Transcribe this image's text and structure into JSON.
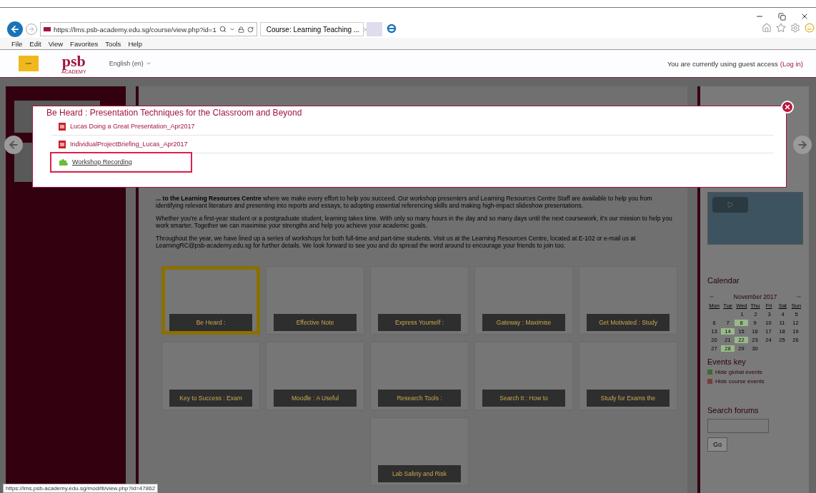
{
  "browser": {
    "address": "https://lms.psb-academy.edu.sg/course/view.php?id=1",
    "tab_title": "Course: Learning Teaching ...",
    "menu": [
      "File",
      "Edit",
      "View",
      "Favorites",
      "Tools",
      "Help"
    ]
  },
  "header": {
    "logo": "psb",
    "logo_sub": "ACADEMY",
    "language": "English (en)",
    "guest_text": "You are currently using guest access",
    "login_link": "(Log in)"
  },
  "modal": {
    "title": "Be Heard : Presentation Techniques for the Classroom and Beyond",
    "items": [
      {
        "kind": "pdf",
        "label": "Lucas Doing a Great Presentation_Apr2017",
        "selected": false
      },
      {
        "kind": "pdf",
        "label": "IndividualProjectBriefing_Lucas_Apr2017",
        "selected": false
      },
      {
        "kind": "tool",
        "label": "Workshop Recording",
        "selected": true
      }
    ]
  },
  "intro": [
    "**... to the Learning Resources Centre** where we make every effort to help you succeed. Our workshop presenters and Learning Resources Centre Staff are available to help you from identifying relevant literature and presenting into reports and essays, to adopting essential referencing skills and making high-impact slideshow presentations.",
    "Whether you're a first-year student or a postgraduate student, learning takes time. With only so many hours in the day and so many days until the next coursework, it's our mission to help you work smarter. Together we can maximise your strengths and help you achieve your academic goals.",
    "Throughout the year, we have lined up a series of workshops for both full-time and part-time students. Visit us at the Learning Resources Centre, located at E-102 or e-mail us at LearningRC@psb-academy.edu.sg for further details. We look forward to see you and do spread the word around to encourage your friends to join too."
  ],
  "tiles": [
    {
      "label": "Be Heard :",
      "selected": true
    },
    {
      "label": "Effective Note",
      "selected": false
    },
    {
      "label": "Express Yourself :",
      "selected": false
    },
    {
      "label": "Gateway : Maximise",
      "selected": false
    },
    {
      "label": "Get Motivated : Study",
      "selected": false
    },
    {
      "label": "Key to Success : Exam",
      "selected": false
    },
    {
      "label": "Moodle : A Useful",
      "selected": false
    },
    {
      "label": "Research Tools :",
      "selected": false
    },
    {
      "label": "Search It : How to",
      "selected": false
    },
    {
      "label": "Study for Exams the",
      "selected": false
    },
    {
      "label": "Lab Safety and Risk",
      "selected": false
    }
  ],
  "calendar": {
    "title": "Calendar",
    "month": "November 2017",
    "weekdays": [
      "Mon",
      "Tue",
      "Wed",
      "Thu",
      "Fri",
      "Sat",
      "Sun"
    ],
    "weeks": [
      [
        {
          "day": "1",
          "event": false
        },
        {
          "day": "2",
          "event": false
        },
        {
          "day": "3",
          "event": false
        },
        {
          "day": "4",
          "event": false
        },
        {
          "day": "5",
          "event": false
        }
      ],
      [
        {
          "day": "6",
          "event": false
        },
        {
          "day": "7",
          "event": false
        },
        {
          "day": "8",
          "event": true
        },
        {
          "day": "9",
          "event": false
        },
        {
          "day": "10",
          "event": false
        },
        {
          "day": "11",
          "event": false
        },
        {
          "day": "12",
          "event": false
        }
      ],
      [
        {
          "day": "13",
          "event": false
        },
        {
          "day": "14",
          "event": true
        },
        {
          "day": "15",
          "event": false
        },
        {
          "day": "16",
          "event": false
        },
        {
          "day": "17",
          "event": false
        },
        {
          "day": "18",
          "event": false
        },
        {
          "day": "19",
          "event": false
        }
      ],
      [
        {
          "day": "20",
          "event": false
        },
        {
          "day": "21",
          "event": false
        },
        {
          "day": "22",
          "event": true
        },
        {
          "day": "23",
          "event": false
        },
        {
          "day": "24",
          "event": false
        },
        {
          "day": "25",
          "event": false
        },
        {
          "day": "26",
          "event": false
        }
      ],
      [
        {
          "day": "27",
          "event": false
        },
        {
          "day": "28",
          "event": true
        },
        {
          "day": "29",
          "event": false
        },
        {
          "day": "30",
          "event": false
        }
      ]
    ]
  },
  "events_key": {
    "title": "Events key",
    "items": [
      {
        "label": "Hide global events",
        "color": "#3c6a30"
      },
      {
        "label": "Hide course events",
        "color": "#7a3c3c"
      }
    ]
  },
  "search_forums": {
    "title": "Search forums",
    "button": "Go"
  },
  "status_url": "https://lms.psb-academy.edu.sg/mod/lti/view.php?id=47862"
}
